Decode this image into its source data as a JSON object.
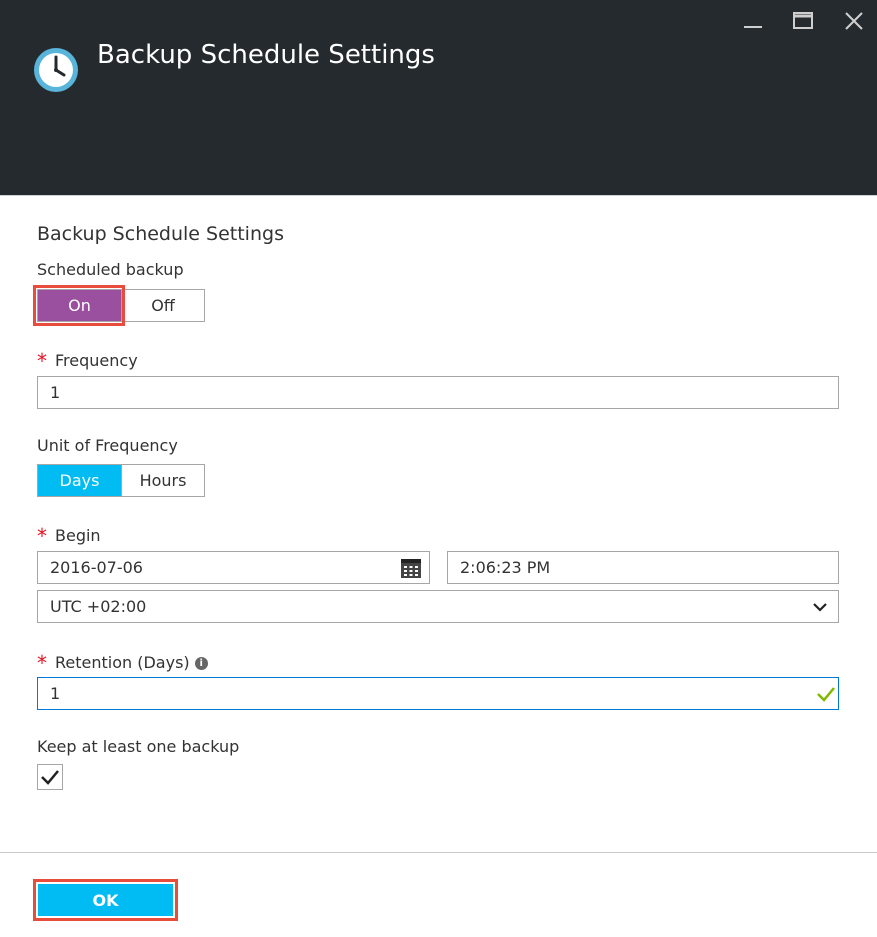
{
  "header": {
    "title": "Backup Schedule Settings",
    "icon": "clock-icon",
    "controls": [
      "minimize-icon",
      "maximize-icon",
      "close-icon"
    ]
  },
  "form": {
    "section_title": "Backup Schedule Settings",
    "scheduled_backup": {
      "label": "Scheduled backup",
      "options": [
        "On",
        "Off"
      ],
      "selected": "On"
    },
    "frequency": {
      "label": "Frequency",
      "required_mark": "*",
      "value": "1"
    },
    "unit_of_frequency": {
      "label": "Unit of Frequency",
      "options": [
        "Days",
        "Hours"
      ],
      "selected": "Days"
    },
    "begin": {
      "label": "Begin",
      "required_mark": "*",
      "date": "2016-07-06",
      "time": "2:06:23 PM",
      "timezone": "UTC +02:00"
    },
    "retention": {
      "label": "Retention (Days)",
      "required_mark": "*",
      "value": "1",
      "info": "i"
    },
    "keep_one": {
      "label": "Keep at least one backup",
      "checked": true
    }
  },
  "footer": {
    "ok_label": "OK"
  },
  "colors": {
    "header_bg": "#252a2e",
    "accent_purple": "#9a4f9f",
    "accent_blue": "#00bcf2",
    "highlight_red": "#e74c3c",
    "valid_green": "#7fba00",
    "required_red": "#e81123"
  }
}
